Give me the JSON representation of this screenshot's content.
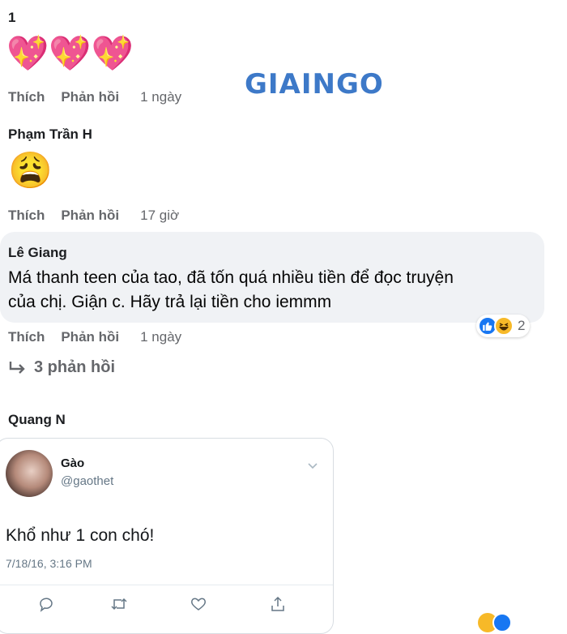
{
  "watermark": "GIAINGO",
  "comments": [
    {
      "author": "1",
      "emoji": "💖💖💖",
      "actions": {
        "like": "Thích",
        "reply": "Phản hồi",
        "time": "1 ngày"
      }
    },
    {
      "author": "Phạm Trần H",
      "emoji": "😩",
      "actions": {
        "like": "Thích",
        "reply": "Phản hồi",
        "time": "17 giờ"
      }
    },
    {
      "author": "Lê Giang",
      "text_line1": "Má thanh teen của tao, đã tốn quá nhiều tiền để đọc truyện",
      "text_line2": "của chị. Giận c. Hãy trả lại tiền cho iemmm",
      "reactions_count": "2",
      "actions": {
        "like": "Thích",
        "reply": "Phản hồi",
        "time": "1 ngày"
      },
      "replies_link": "3 phản hồi"
    },
    {
      "author": "Quang N"
    }
  ],
  "tweet": {
    "name": "Gào",
    "handle": "@gaothet",
    "text": "Khổ như 1 con chó!",
    "timestamp": "7/18/16, 3:16 PM"
  },
  "icons": [
    "like-reaction-icon",
    "haha-reaction-icon",
    "reply-arrow-icon",
    "chevron-down-icon",
    "tweet-reply-icon",
    "retweet-icon",
    "tweet-like-icon",
    "tweet-share-icon"
  ],
  "colors": {
    "like_blue": "#1877f2",
    "haha_yellow": "#f7b928",
    "watermark_blue": "#3d79c8"
  }
}
